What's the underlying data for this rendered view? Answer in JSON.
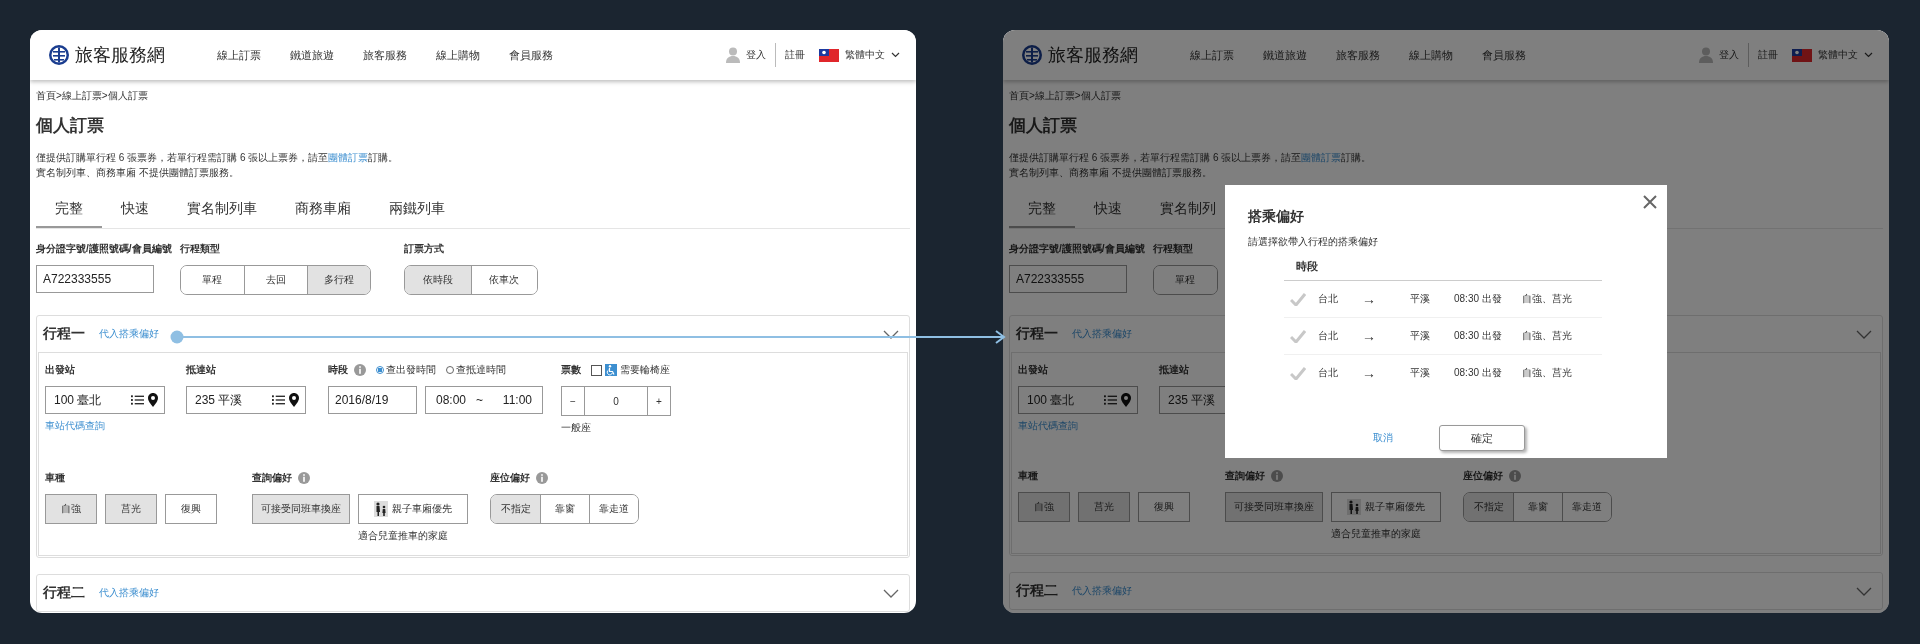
{
  "screens": [
    {
      "header": {
        "logo": "旅客服務網",
        "nav": [
          "線上訂票",
          "鐵道旅遊",
          "旅客服務",
          "線上購物",
          "會員服務"
        ],
        "login": "登入",
        "register": "註冊",
        "language": "繁體中文"
      },
      "breadcrumb": "首頁>線上訂票>個人訂票",
      "title": "個人訂票",
      "notice": {
        "before": "僅提供訂購單行程 6 張票券，若單行程需訂購 6 張以上票券，請至",
        "link": "團體訂票",
        "after": "訂購。",
        "line2": "實名制列車、商務車廂 不提供團體訂票服務。"
      },
      "tabs": [
        {
          "label": "完整",
          "selected": true
        },
        {
          "label": "快速",
          "selected": false
        },
        {
          "label": "實名制列車",
          "selected": false
        },
        {
          "label": "商務車廂",
          "selected": false
        },
        {
          "label": "兩鐵列車",
          "selected": false
        }
      ],
      "id_field": {
        "label": "身分證字號/護照號碼/會員編號",
        "value": "A722333555"
      },
      "trip_type": {
        "label": "行程類型",
        "options": [
          {
            "label": "單程",
            "selected": false
          },
          {
            "label": "去回",
            "selected": false
          },
          {
            "label": "多行程",
            "selected": true
          }
        ]
      },
      "booking_method": {
        "label": "訂票方式",
        "options": [
          {
            "label": "依時段",
            "selected": true
          },
          {
            "label": "依車次",
            "selected": false
          }
        ]
      },
      "trips": [
        {
          "title": "行程一",
          "prefill_link": "代入搭乘偏好",
          "expanded": true,
          "departure": {
            "label": "出發站",
            "value": "100 臺北"
          },
          "arrival": {
            "label": "抵達站",
            "value": "235 平溪"
          },
          "station_code_link": "車站代碼查詢",
          "time": {
            "label": "時段",
            "modes": [
              {
                "label": "查出發時間",
                "selected": true
              },
              {
                "label": "查抵達時間",
                "selected": false
              }
            ],
            "date": "2016/8/19",
            "start": "08:00",
            "tilde": "~",
            "end": "11:00"
          },
          "tickets": {
            "label": "票數",
            "wheelchair": {
              "label": "需要輪椅座",
              "checked": false
            },
            "minus": "−",
            "count": "0",
            "plus": "+",
            "seat_class": "一般座"
          },
          "train_types": {
            "label": "車種",
            "options": [
              {
                "label": "自強",
                "selected": true
              },
              {
                "label": "莒光",
                "selected": true
              },
              {
                "label": "復興",
                "selected": false
              }
            ]
          },
          "query_pref": {
            "label": "查詢偏好",
            "options": [
              {
                "label": "可接受同班車換座",
                "selected": true,
                "kind": "plain"
              },
              {
                "label": "親子車廂優先",
                "selected": false,
                "kind": "family"
              }
            ],
            "note": "適合兒童推車的家庭"
          },
          "seat_pref": {
            "label": "座位偏好",
            "options": [
              {
                "label": "不指定",
                "selected": true
              },
              {
                "label": "靠窗",
                "selected": false
              },
              {
                "label": "靠走道",
                "selected": false
              }
            ]
          }
        },
        {
          "title": "行程二",
          "prefill_link": "代入搭乘偏好",
          "expanded": false
        }
      ]
    },
    {
      "header": {
        "logo": "旅客服務網",
        "nav": [
          "線上訂票",
          "鐵道旅遊",
          "旅客服務",
          "線上購物",
          "會員服務"
        ],
        "login": "登入",
        "register": "註冊",
        "language": "繁體中文"
      },
      "breadcrumb": "首頁>線上訂票>個人訂票",
      "title": "個人訂票",
      "notice": {
        "before": "僅提供訂購單行程 6 張票券，若單行程需訂購 6 張以上票券，請至",
        "link": "團體訂票",
        "after": "訂購。",
        "line2": "實名制列車、商務車廂 不提供團體訂票服務。"
      },
      "tabs": [
        {
          "label": "完整",
          "selected": true
        },
        {
          "label": "快速",
          "selected": false
        },
        {
          "label": "實名制列",
          "selected": false
        }
      ],
      "id_field": {
        "label": "身分證字號/護照號碼/會員編號",
        "value": "A722333555"
      },
      "trip_type": {
        "label": "行程類型",
        "options": [
          {
            "label": "單程",
            "selected": false
          }
        ]
      },
      "trips": [
        {
          "title": "行程一",
          "prefill_link": "代入搭乘偏好",
          "expanded": true,
          "departure": {
            "label": "出發站",
            "value": "100 臺北"
          },
          "arrival": {
            "label": "抵達站",
            "value": "235 平溪"
          },
          "station_code_link": "車站代碼查詢",
          "train_types": {
            "label": "車種",
            "options": [
              {
                "label": "自強",
                "selected": true
              },
              {
                "label": "莒光",
                "selected": true
              },
              {
                "label": "復興",
                "selected": false
              }
            ]
          },
          "query_pref": {
            "label": "查詢偏好",
            "options": [
              {
                "label": "可接受同班車換座",
                "selected": true,
                "kind": "plain"
              },
              {
                "label": "親子車廂優先",
                "selected": false,
                "kind": "family"
              }
            ],
            "note": "適合兒童推車的家庭"
          },
          "seat_pref": {
            "label": "座位偏好",
            "options": [
              {
                "label": "不指定",
                "selected": true
              },
              {
                "label": "靠窗",
                "selected": false
              },
              {
                "label": "靠走道",
                "selected": false
              }
            ]
          }
        },
        {
          "title": "行程二",
          "prefill_link": "代入搭乘偏好",
          "expanded": false
        }
      ],
      "modal": {
        "title": "搭乘偏好",
        "subtitle": "請選擇欲帶入行程的搭乘偏好",
        "column": "時段",
        "rows": [
          {
            "from": "台北",
            "arrow": "→",
            "to": "平溪",
            "time": "08:30 出發",
            "trains": "自強、莒光",
            "checked": false
          },
          {
            "from": "台北",
            "arrow": "→",
            "to": "平溪",
            "time": "08:30 出發",
            "trains": "自強、莒光",
            "checked": false
          },
          {
            "from": "台北",
            "arrow": "→",
            "to": "平溪",
            "time": "08:30 出發",
            "trains": "自強、莒光",
            "checked": false
          }
        ],
        "cancel": "取消",
        "confirm": "確定"
      }
    }
  ]
}
